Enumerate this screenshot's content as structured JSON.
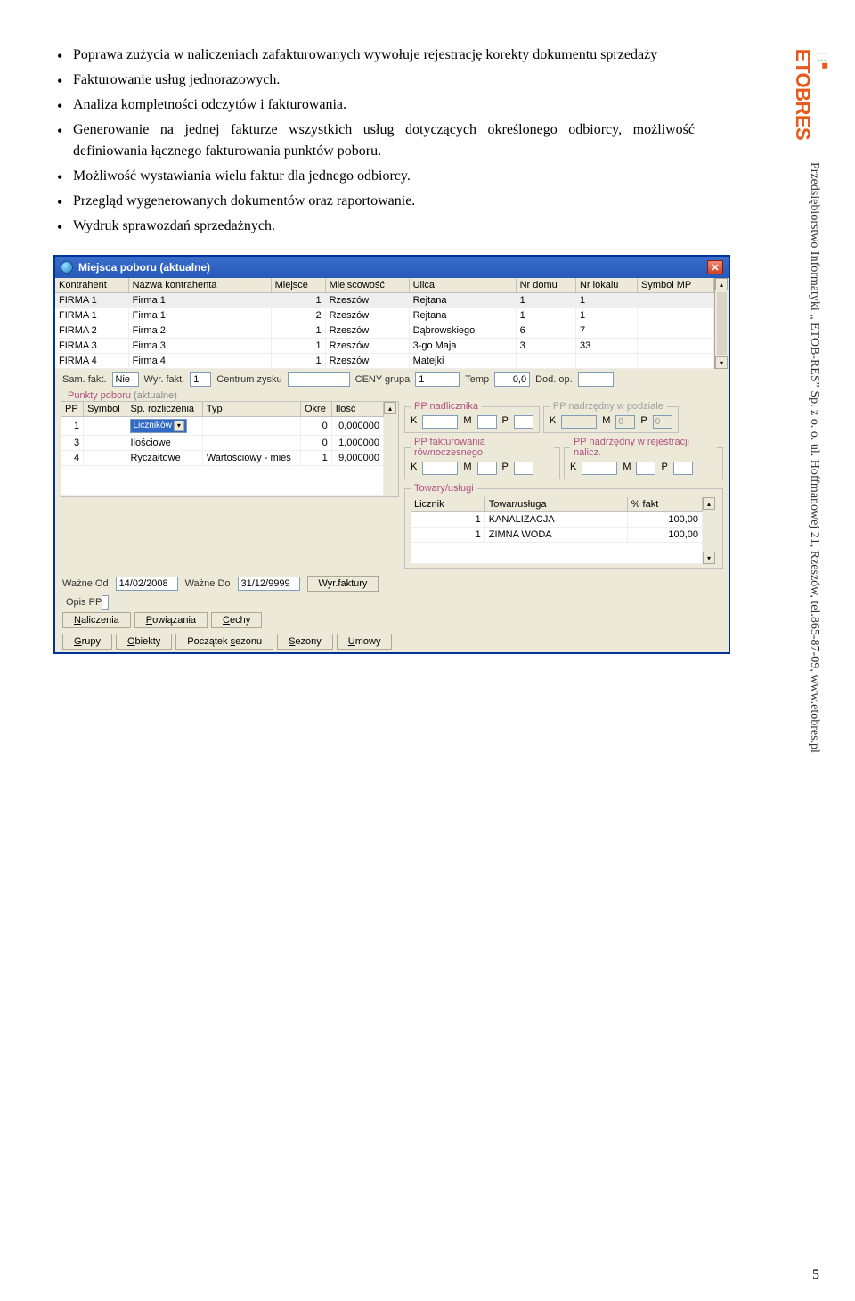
{
  "bullets": [
    "Poprawa zużycia w naliczeniach zafakturowanych wywołuje rejestrację korekty dokumentu sprzedaży",
    "Fakturowanie usług jednorazowych.",
    "Analiza kompletności odczytów i fakturowania.",
    "Generowanie na jednej fakturze wszystkich usług dotyczących określonego odbiorcy, możliwość definiowania łącznego fakturowania punktów poboru.",
    "Możliwość wystawiania wielu faktur dla jednego odbiorcy.",
    "Przegląd wygenerowanych dokumentów oraz raportowanie.",
    "Wydruk sprawozdań sprzedażnych."
  ],
  "win": {
    "title": "Miejsca poboru (aktualne)",
    "table": {
      "headers": [
        "Kontrahent",
        "Nazwa kontrahenta",
        "Miejsce",
        "Miejscowość",
        "Ulica",
        "Nr domu",
        "Nr lokalu",
        "Symbol MP"
      ],
      "rows": [
        [
          "FIRMA 1",
          "Firma 1",
          "1",
          "Rzeszów",
          "Rejtana",
          "1",
          "1",
          ""
        ],
        [
          "FIRMA 1",
          "Firma 1",
          "2",
          "Rzeszów",
          "Rejtana",
          "1",
          "1",
          ""
        ],
        [
          "FIRMA 2",
          "Firma 2",
          "1",
          "Rzeszów",
          "Dąbrowskiego",
          "6",
          "7",
          ""
        ],
        [
          "FIRMA 3",
          "Firma 3",
          "1",
          "Rzeszów",
          "3-go Maja",
          "3",
          "33",
          ""
        ],
        [
          "FIRMA 4",
          "Firma 4",
          "1",
          "Rzeszów",
          "Matejki",
          "",
          "",
          ""
        ]
      ]
    },
    "formrow": {
      "sam_fakt_label": "Sam. fakt.",
      "sam_fakt": "Nie",
      "wyr_fakt_label": "Wyr. fakt.",
      "wyr_fakt": "1",
      "centrum_label": "Centrum zysku",
      "centrum": "",
      "ceny_label": "CENY grupa",
      "ceny": "1",
      "temp_label": "Temp",
      "temp": "0,0",
      "dod_label": "Dod. op.",
      "dod": ""
    },
    "punkty_legend": "Punkty poboru",
    "aktualne": "(aktualne)",
    "punkty_table": {
      "headers": [
        "PP",
        "Symbol",
        "Sp. rozliczenia",
        "Typ",
        "Okre",
        "Ilość"
      ],
      "rows": [
        [
          "1",
          "",
          "Liczników",
          "",
          "0",
          "0,000000"
        ],
        [
          "3",
          "",
          "Ilościowe",
          "",
          "0",
          "1,000000"
        ],
        [
          "4",
          "",
          "Ryczałtowe",
          "Wartościowy - mies",
          "1",
          "9,000000"
        ]
      ]
    },
    "groups": {
      "g1_legend": "PP nadlicznika",
      "g2_legend": "PP nadrzędny w podziale",
      "g3_legend": "PP fakturowania równoczesnego",
      "g4_legend": "PP nadrzędny w rejestracji nalicz.",
      "labels": {
        "K": "K",
        "M": "M",
        "P": "P",
        "O": "0"
      }
    },
    "towary_legend": "Towary/usługi",
    "towary_table": {
      "headers": [
        "Licznik",
        "Towar/usługa",
        "% fakt"
      ],
      "rows": [
        [
          "1",
          "KANALIZACJA",
          "100,00"
        ],
        [
          "1",
          "ZIMNA WODA",
          "100,00"
        ]
      ]
    },
    "dates": {
      "wazne_od_label": "Ważne Od",
      "wazne_od": "14/02/2008",
      "wazne_do_label": "Ważne Do",
      "wazne_do": "31/12/9999",
      "wyr_btn": "Wyr.faktury"
    },
    "opis_label": "Opis PP",
    "opis": "",
    "buttons_row1": [
      "Naliczenia",
      "Powiązania",
      "Cechy"
    ],
    "buttons_row2": [
      "Grupy",
      "Obiekty",
      "Początek sezonu",
      "Sezony",
      "Umowy"
    ]
  },
  "sidebar": {
    "logo_text": "ETOBRES",
    "company": "Przedsiębiorstwo Informatyki „ ETOB-RES” Sp. z o. o. ul. Hoffmanowej 21, Rzeszów, tel.865-87-09, www.etobres.pl"
  },
  "page_number": "5"
}
